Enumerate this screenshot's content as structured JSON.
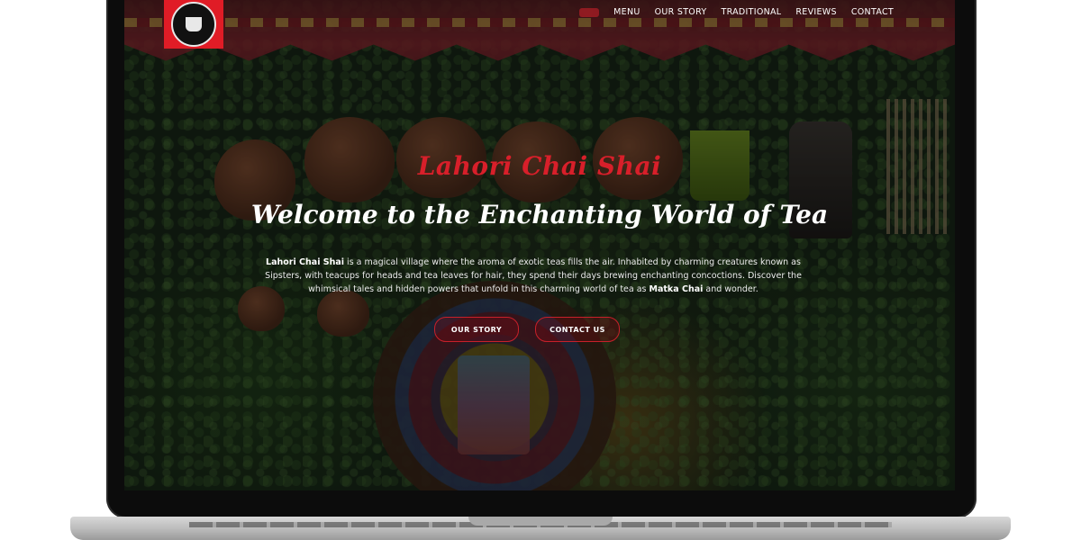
{
  "nav": {
    "items": [
      {
        "label": "MENU"
      },
      {
        "label": "OUR STORY"
      },
      {
        "label": "TRADITIONAL"
      },
      {
        "label": "REVIEWS"
      },
      {
        "label": "CONTACT"
      }
    ]
  },
  "hero": {
    "brand": "Lahori Chai Shai",
    "title": "Welcome to the Enchanting World of Tea",
    "text_brand": "Lahori Chai Shai",
    "text_body": " is a magical village where the aroma of exotic teas fills the air. Inhabited by charming creatures known as Sipsters, with teacups for heads and tea leaves for hair, they spend their days brewing enchanting concoctions. Discover the whimsical tales and hidden powers that unfold in this charming world of tea as ",
    "text_emph": "Matka Chai",
    "text_end": " and wonder."
  },
  "buttons": {
    "story": "OUR STORY",
    "contact": "CONTACT US"
  },
  "colors": {
    "accent": "#d81f2a",
    "logo_bg": "#e01c26"
  }
}
